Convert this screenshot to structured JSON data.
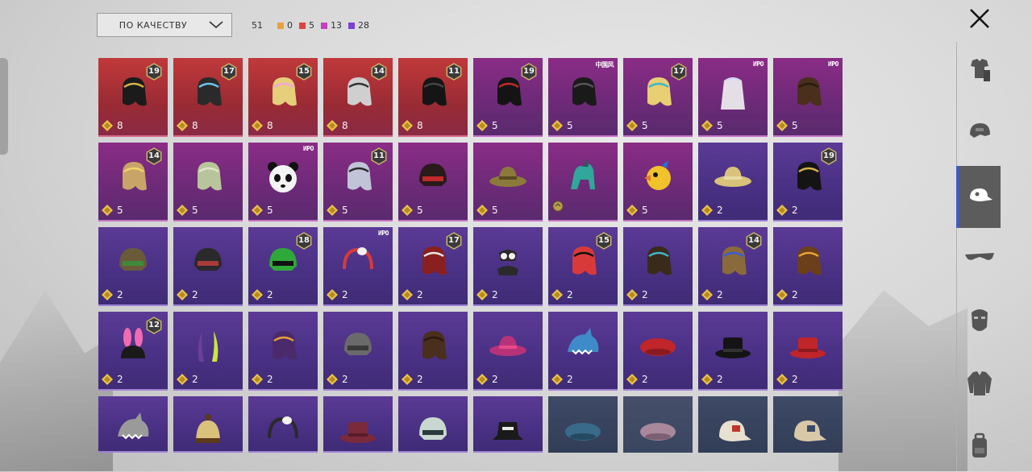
{
  "sort": {
    "label": "ПО КАЧЕСТВУ"
  },
  "counts": {
    "total": "51",
    "items": [
      {
        "value": "0",
        "color": "#e8a23a"
      },
      {
        "value": "5",
        "color": "#e0433f"
      },
      {
        "value": "13",
        "color": "#c43fc1"
      },
      {
        "value": "28",
        "color": "#7b3fd6"
      }
    ]
  },
  "sidebar": {
    "items": [
      {
        "icon": "outfit-icon",
        "active": false
      },
      {
        "icon": "helmet-icon",
        "active": false
      },
      {
        "icon": "cap-icon",
        "active": true
      },
      {
        "icon": "glasses-icon",
        "active": false
      },
      {
        "icon": "mask-icon",
        "active": false
      },
      {
        "icon": "jacket-icon",
        "active": false
      },
      {
        "icon": "backpack-icon",
        "active": false
      }
    ]
  },
  "items": [
    {
      "q": "red",
      "level": "19",
      "price": "8",
      "art": "hair",
      "color": "#1b1b1b",
      "accent": "#d8b24a"
    },
    {
      "q": "red",
      "level": "17",
      "price": "8",
      "art": "hair",
      "color": "#2a2a2a",
      "accent": "#6ec3e8"
    },
    {
      "q": "red",
      "level": "15",
      "price": "8",
      "art": "hair",
      "color": "#e6cf7a",
      "accent": "#f2a6d8"
    },
    {
      "q": "red",
      "level": "14",
      "price": "8",
      "art": "hair",
      "color": "#cfcfcf",
      "accent": "#333333"
    },
    {
      "q": "red",
      "level": "11",
      "price": "8",
      "art": "hair",
      "color": "#151515",
      "accent": "#444444"
    },
    {
      "q": "mag",
      "level": "19",
      "price": "5",
      "art": "hair",
      "color": "#141414",
      "accent": "#c02a2a"
    },
    {
      "q": "mag",
      "tag": "中国风",
      "price": "5",
      "art": "hair",
      "color": "#1a1a1a",
      "accent": "#555555"
    },
    {
      "q": "mag",
      "level": "17",
      "price": "5",
      "art": "hair",
      "color": "#e8cf73",
      "accent": "#3fb6c9"
    },
    {
      "q": "mag",
      "tag": "ИРО",
      "price": "5",
      "art": "veil",
      "color": "#f2f2f2",
      "accent": "#d0d0ff"
    },
    {
      "q": "mag",
      "tag": "ИРО",
      "price": "5",
      "art": "hair",
      "color": "#4a2f1c",
      "accent": "#2a1a10"
    },
    {
      "q": "mag",
      "level": "14",
      "price": "5",
      "art": "hair",
      "color": "#c9a468",
      "accent": "#f2d36a"
    },
    {
      "q": "mag",
      "price": "5",
      "art": "hair",
      "color": "#b8c59a",
      "accent": "#dfe6c9"
    },
    {
      "q": "mag",
      "tag": "ИРО",
      "price": "5",
      "art": "panda",
      "color": "#f4f4f4",
      "accent": "#111111"
    },
    {
      "q": "mag",
      "level": "11",
      "price": "5",
      "art": "hair",
      "color": "#c0c4d6",
      "accent": "#2b2b2b"
    },
    {
      "q": "mag",
      "price": "5",
      "art": "helmet",
      "color": "#2a1a1a",
      "accent": "#c02a2a"
    },
    {
      "q": "mag",
      "price": "5",
      "art": "hat",
      "color": "#8b7a3a",
      "accent": "#5a4a20"
    },
    {
      "q": "mag",
      "price": "",
      "art": "creature",
      "color": "#2fa79a",
      "accent": "#1d5e5a",
      "ring": true
    },
    {
      "q": "mag",
      "price": "5",
      "art": "duck",
      "color": "#f2c22a",
      "accent": "#2a6ed8"
    },
    {
      "q": "pur",
      "price": "2",
      "art": "hat",
      "color": "#d9c27a",
      "accent": "#e8dba0"
    },
    {
      "q": "pur",
      "level": "19",
      "price": "2",
      "art": "hair",
      "color": "#141414",
      "accent": "#d8b24a"
    },
    {
      "q": "pur",
      "price": "2",
      "art": "helmet",
      "color": "#6a5a3a",
      "accent": "#3f8a3a"
    },
    {
      "q": "pur",
      "price": "2",
      "art": "helmet",
      "color": "#2a2a2a",
      "accent": "#a83a3a"
    },
    {
      "q": "pur",
      "level": "18",
      "price": "2",
      "art": "helmet",
      "color": "#2fa83a",
      "accent": "#111111"
    },
    {
      "q": "pur",
      "tag": "ИРО",
      "price": "2",
      "art": "band",
      "color": "#d83a3a",
      "accent": "#f2f2f2"
    },
    {
      "q": "pur",
      "level": "17",
      "price": "2",
      "art": "hair",
      "color": "#8a1f1f",
      "accent": "#e8e8e8"
    },
    {
      "q": "pur",
      "price": "2",
      "art": "goggles",
      "color": "#2a2a2a",
      "accent": "#f2f2f2"
    },
    {
      "q": "pur",
      "level": "15",
      "price": "2",
      "art": "hair",
      "color": "#d83a3a",
      "accent": "#111111"
    },
    {
      "q": "pur",
      "price": "2",
      "art": "hair",
      "color": "#3a2a1a",
      "accent": "#3fb6c9"
    },
    {
      "q": "pur",
      "level": "14",
      "price": "2",
      "art": "hair",
      "color": "#8a6a3a",
      "accent": "#3a5bd8"
    },
    {
      "q": "pur",
      "price": "2",
      "art": "hair",
      "color": "#6a3f1a",
      "accent": "#e8a23a"
    },
    {
      "q": "pur",
      "level": "12",
      "price": "2",
      "art": "ears",
      "color": "#1a1a1a",
      "accent": "#f26ab2"
    },
    {
      "q": "pur",
      "price": "2",
      "art": "horns",
      "color": "#6a3f9a",
      "accent": "#c8e83a"
    },
    {
      "q": "pur",
      "price": "2",
      "art": "hair",
      "color": "#4a2a6a",
      "accent": "#e8a23a"
    },
    {
      "q": "pur",
      "price": "2",
      "art": "helmet",
      "color": "#6a6a6a",
      "accent": "#3a3a3a"
    },
    {
      "q": "pur",
      "price": "2",
      "art": "hair",
      "color": "#4a2f1c",
      "accent": "#2a1a10"
    },
    {
      "q": "pur",
      "price": "2",
      "art": "hat",
      "color": "#b8327a",
      "accent": "#e84a8a"
    },
    {
      "q": "pur",
      "price": "2",
      "art": "shark",
      "color": "#3f8ac9",
      "accent": "#ffffff"
    },
    {
      "q": "pur",
      "price": "2",
      "art": "beret",
      "color": "#c0252a",
      "accent": "#8a1a1f"
    },
    {
      "q": "pur",
      "price": "2",
      "art": "tophat",
      "color": "#141414",
      "accent": "#333333"
    },
    {
      "q": "pur",
      "price": "2",
      "art": "tophat",
      "color": "#c0252a",
      "accent": "#8a1a1f"
    },
    {
      "q": "pur",
      "art": "shark",
      "color": "#9a9a9a",
      "accent": "#ffffff"
    },
    {
      "q": "pur",
      "art": "beanie",
      "color": "#d9c27a",
      "accent": "#5a3a1a"
    },
    {
      "q": "pur",
      "art": "band",
      "color": "#2a2a2a",
      "accent": "#f2f2f2"
    },
    {
      "q": "pur",
      "art": "tophat",
      "color": "#7a2a3a",
      "accent": "#5a1a2a"
    },
    {
      "q": "pur",
      "art": "helmet",
      "color": "#c8d8d0",
      "accent": "#2a3a3a"
    },
    {
      "q": "pur",
      "art": "bucket",
      "color": "#1a1a1a",
      "accent": "#e8e8e8"
    },
    {
      "q": "blu",
      "art": "beret",
      "color": "#3a6a8a",
      "accent": "#254a60"
    },
    {
      "q": "blu2",
      "art": "beret",
      "color": "#a8889a",
      "accent": "#7a6070"
    },
    {
      "q": "blu",
      "art": "cap",
      "color": "#e8e0d0",
      "accent": "#c0352a"
    },
    {
      "q": "blu",
      "art": "cap",
      "color": "#d8c8a8",
      "accent": "#3a4a6a"
    }
  ]
}
